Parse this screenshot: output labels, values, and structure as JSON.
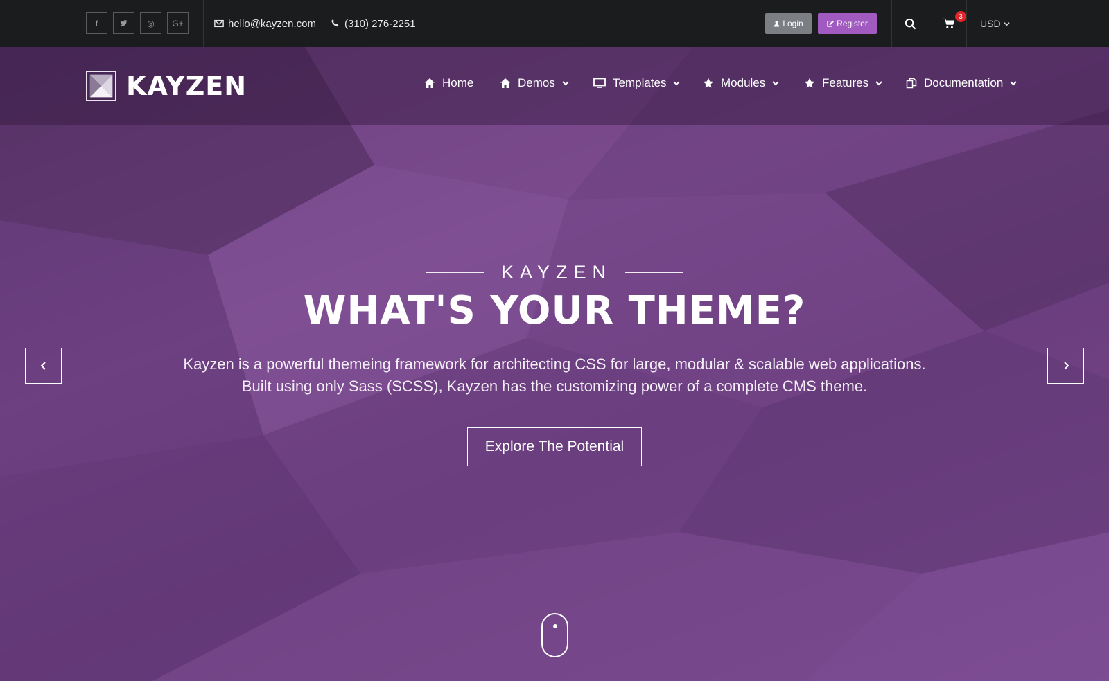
{
  "topbar": {
    "socials": [
      {
        "icon": "facebook-icon",
        "glyph": "f"
      },
      {
        "icon": "twitter-icon",
        "glyph": "t"
      },
      {
        "icon": "dribbble-icon",
        "glyph": "◎"
      },
      {
        "icon": "google-plus-icon",
        "glyph": "G+"
      }
    ],
    "email": "hello@kayzen.com",
    "phone": "(310) 276-2251",
    "login_label": "Login",
    "register_label": "Register",
    "cart_count": "3",
    "currency": "USD"
  },
  "brand": {
    "name": "KAYZEN"
  },
  "nav": {
    "items": [
      {
        "label": "Home",
        "icon": "home-icon"
      },
      {
        "label": "Demos",
        "icon": "home-icon"
      },
      {
        "label": "Templates",
        "icon": "monitor-icon"
      },
      {
        "label": "Modules",
        "icon": "star-icon"
      },
      {
        "label": "Features",
        "icon": "star-icon"
      },
      {
        "label": "Documentation",
        "icon": "documents-icon"
      }
    ]
  },
  "hero": {
    "eyebrow": "KAYZEN",
    "headline": "WHAT'S YOUR THEME?",
    "description_line1": "Kayzen is a powerful themeing framework for architecting CSS for large, modular & scalable web applications.",
    "description_line2": "Built using only Sass (SCSS), Kayzen has the customizing power of a complete CMS theme.",
    "cta_label": "Explore The Potential"
  },
  "colors": {
    "topbar_bg": "#1b1c1d",
    "hero_purple": "#6b3c7c",
    "register_purple": "#a05ac0",
    "login_gray": "#7b7f84",
    "badge_red": "#e0262a"
  }
}
